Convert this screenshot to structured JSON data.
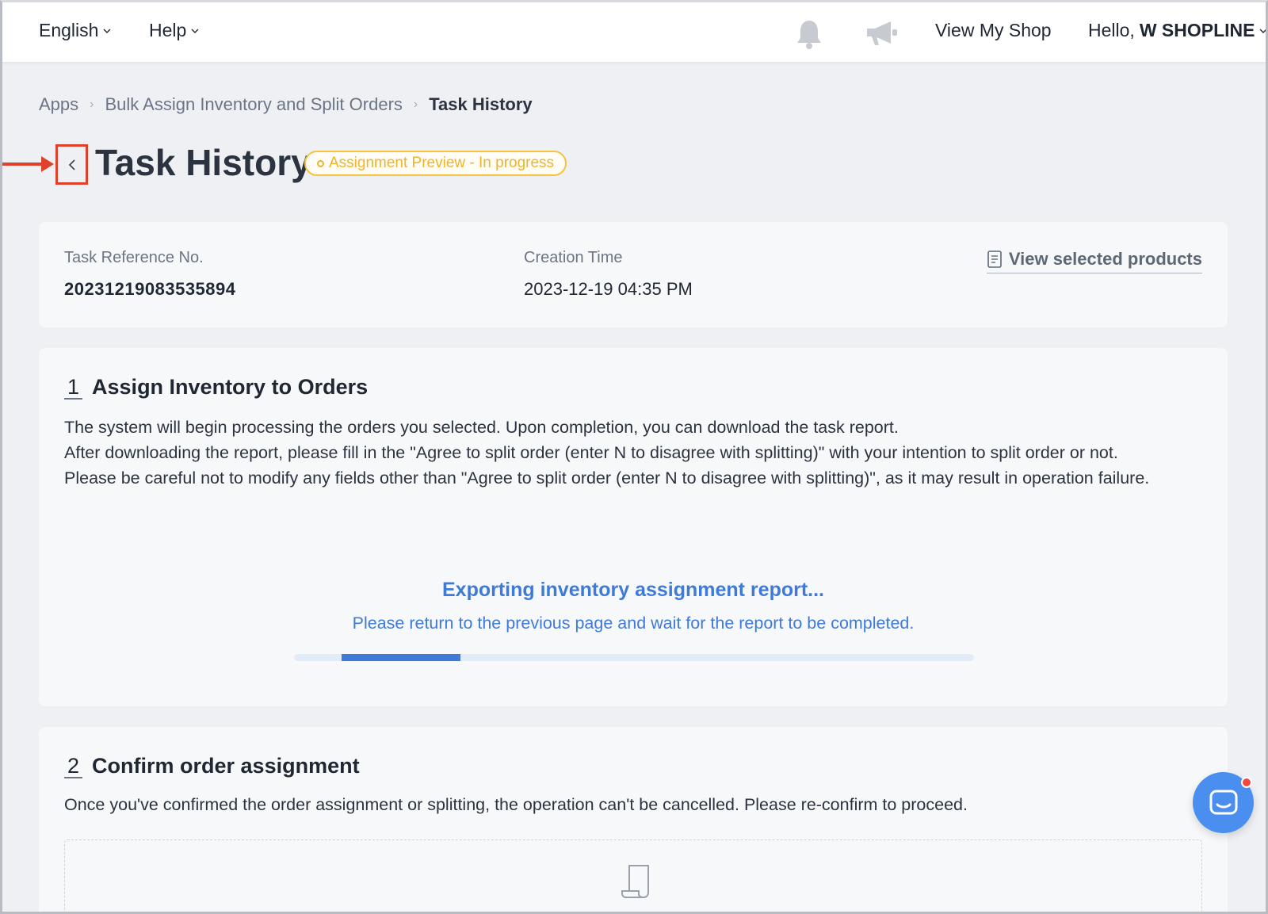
{
  "topbar": {
    "language": "English",
    "help": "Help",
    "view_shop": "View My Shop",
    "greeting_prefix": "Hello,",
    "shop_name": "W SHOPLINE"
  },
  "breadcrumb": {
    "items": [
      "Apps",
      "Bulk Assign Inventory and Split Orders",
      "Task History"
    ]
  },
  "page": {
    "title": "Task History",
    "status": "Assignment Preview - In progress"
  },
  "task_info": {
    "ref_label": "Task Reference No.",
    "ref_value": "20231219083535894",
    "time_label": "Creation Time",
    "time_value": "2023-12-19 04:35 PM",
    "view_products": "View selected products"
  },
  "step1": {
    "number": "1",
    "title": "Assign Inventory to Orders",
    "lines": [
      "The system will begin processing the orders you selected. Upon completion, you can download the task report.",
      "After downloading the report, please fill in the \"Agree to split order (enter N to disagree with splitting)\" with your intention to split order or not.",
      "Please be careful not to modify any fields other than \"Agree to split order (enter N to disagree with splitting)\", as it may result in operation failure."
    ],
    "export_title": "Exporting inventory assignment report...",
    "export_sub": "Please return to the previous page and wait for the report to be completed.",
    "progress_start": 0.07,
    "progress_end": 0.245
  },
  "step2": {
    "number": "2",
    "title": "Confirm order assignment",
    "desc": "Once you've confirmed the order assignment or splitting, the operation can't be cancelled. Please re-confirm to proceed."
  },
  "colors": {
    "accent_blue": "#3f7ad9",
    "status_yellow": "#f0b429",
    "highlight_red": "#e0412a"
  }
}
